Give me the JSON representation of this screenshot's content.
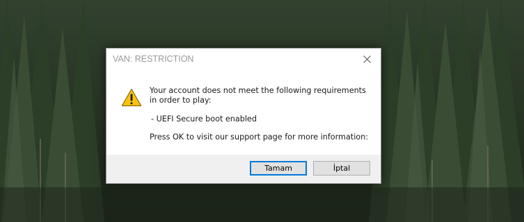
{
  "dialog": {
    "title": "VAN: RESTRICTION",
    "icon": "warning-icon",
    "message_line1": "Your account does not meet the following requirements in order to play:",
    "requirement": "- UEFI Secure boot enabled",
    "support_text": "Press OK to visit our support page for more information:",
    "ok_label": "Tamam",
    "cancel_label": "İptal"
  },
  "colors": {
    "accent": "#0078d7",
    "warning_fill": "#f8c311",
    "dialog_footer": "#f0f0f0"
  }
}
